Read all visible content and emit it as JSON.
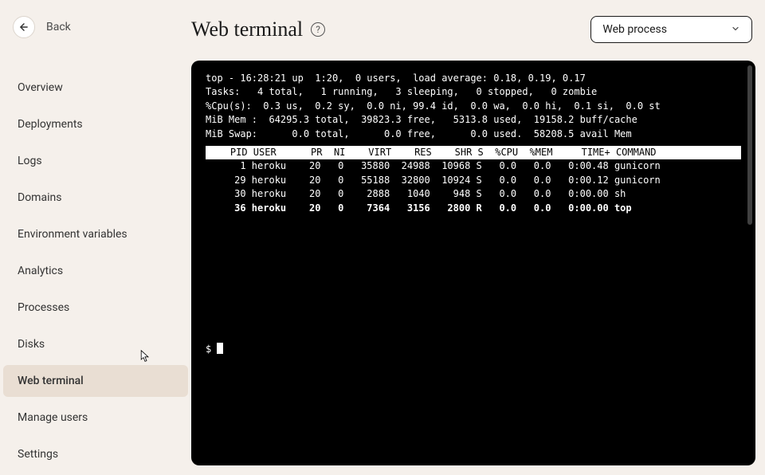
{
  "back": {
    "label": "Back"
  },
  "sidebar": {
    "items": [
      {
        "label": "Overview"
      },
      {
        "label": "Deployments"
      },
      {
        "label": "Logs"
      },
      {
        "label": "Domains"
      },
      {
        "label": "Environment variables"
      },
      {
        "label": "Analytics"
      },
      {
        "label": "Processes"
      },
      {
        "label": "Disks"
      },
      {
        "label": "Web terminal"
      },
      {
        "label": "Manage users"
      },
      {
        "label": "Settings"
      }
    ]
  },
  "header": {
    "title": "Web terminal",
    "dropdown_selected": "Web process"
  },
  "terminal": {
    "summary": {
      "line1": "top - 16:28:21 up  1:20,  0 users,  load average: 0.18, 0.19, 0.17",
      "line2": "Tasks:   4 total,   1 running,   3 sleeping,   0 stopped,   0 zombie",
      "line3": "%Cpu(s):  0.3 us,  0.2 sy,  0.0 ni, 99.4 id,  0.0 wa,  0.0 hi,  0.1 si,  0.0 st",
      "line4": "MiB Mem :  64295.3 total,  39823.3 free,   5313.8 used,  19158.2 buff/cache",
      "line5": "MiB Swap:      0.0 total,      0.0 free,      0.0 used.  58208.5 avail Mem"
    },
    "header_row": "    PID USER      PR  NI    VIRT    RES    SHR S  %CPU  %MEM     TIME+ COMMAND ",
    "rows": [
      "      1 heroku    20   0   35880  24988  10968 S   0.0   0.0   0:00.48 gunicorn",
      "     29 heroku    20   0   55188  32800  10924 S   0.0   0.0   0:00.12 gunicorn",
      "     30 heroku    20   0    2888   1040    948 S   0.0   0.0   0:00.00 sh",
      "     36 heroku    20   0    7364   3156   2800 R   0.0   0.0   0:00.00 top"
    ],
    "prompt": "$ "
  }
}
